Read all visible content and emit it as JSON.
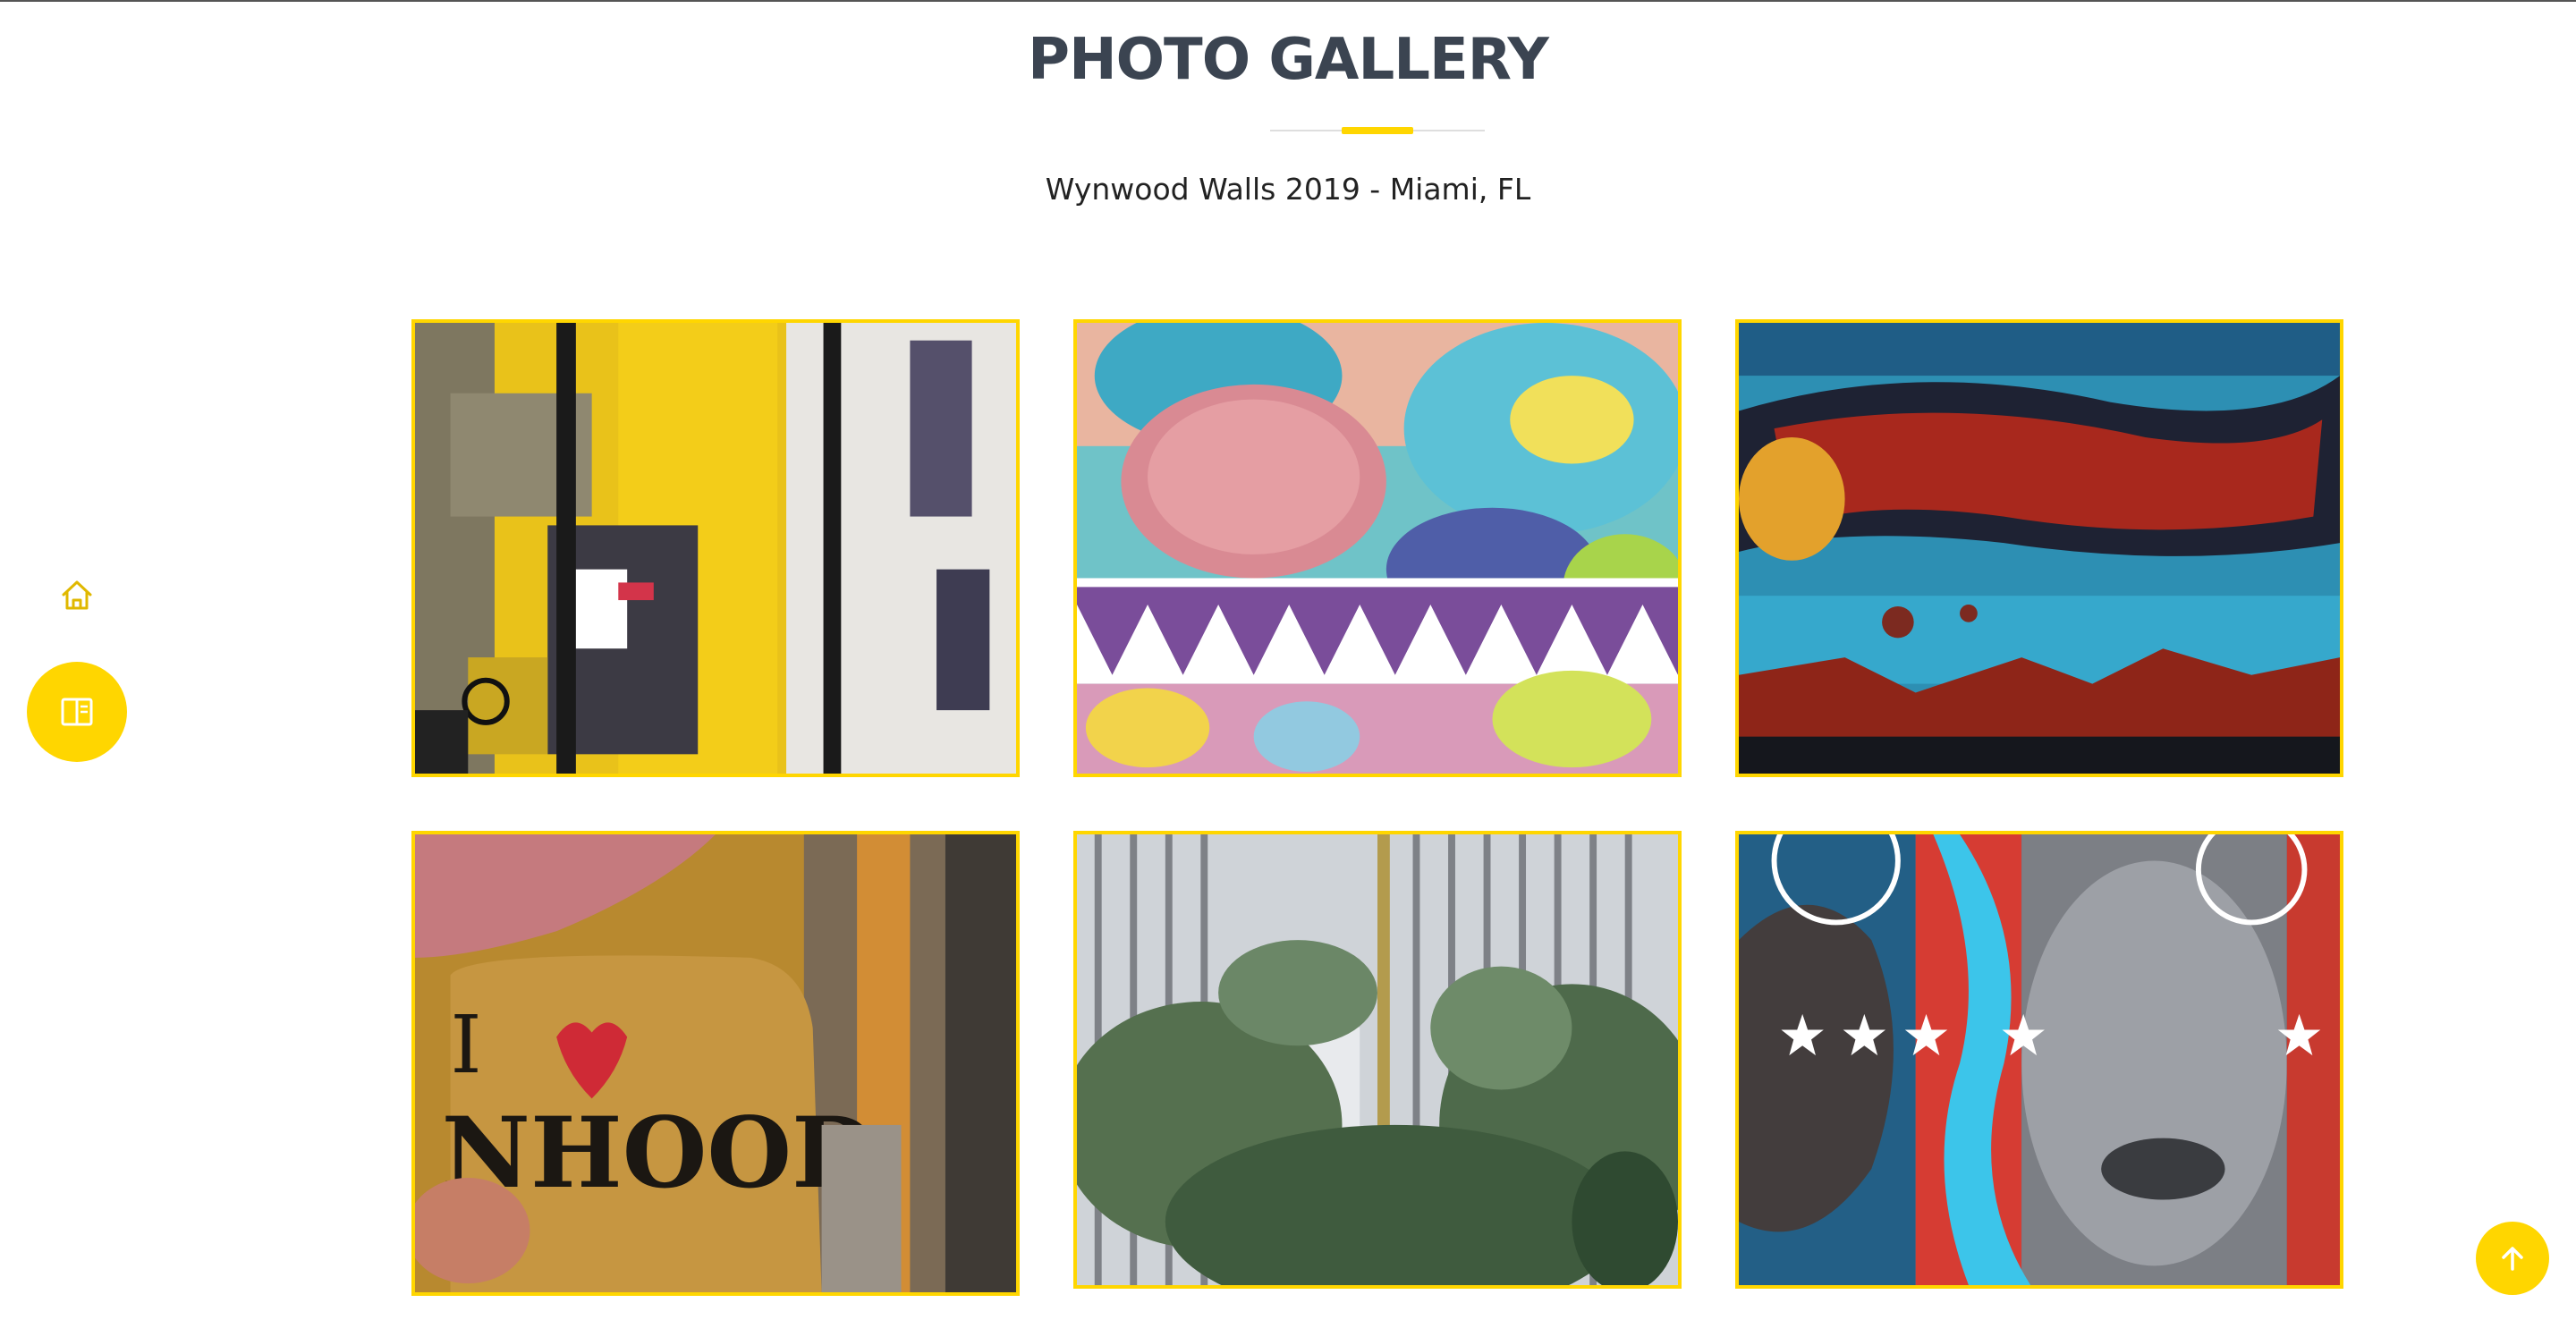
{
  "header": {
    "title": "PHOTO GALLERY",
    "subtitle": "Wynwood Walls 2019 - Miami, FL"
  },
  "colors": {
    "accent": "#ffd600",
    "title": "#3b4451",
    "divider": "#dedede"
  },
  "nav": {
    "home_icon": "home-icon",
    "book_icon": "book-icon",
    "scroll_top_icon": "arrow-up-icon"
  },
  "gallery": {
    "photos": [
      {
        "name": "photo-yellow-abstract-mural"
      },
      {
        "name": "photo-cartoon-faces-mural"
      },
      {
        "name": "photo-red-figure-space-mural"
      },
      {
        "name": "photo-i-love-wynwood-mural"
      },
      {
        "name": "photo-jungle-gate-mural"
      },
      {
        "name": "photo-faces-stars-mural"
      }
    ]
  }
}
